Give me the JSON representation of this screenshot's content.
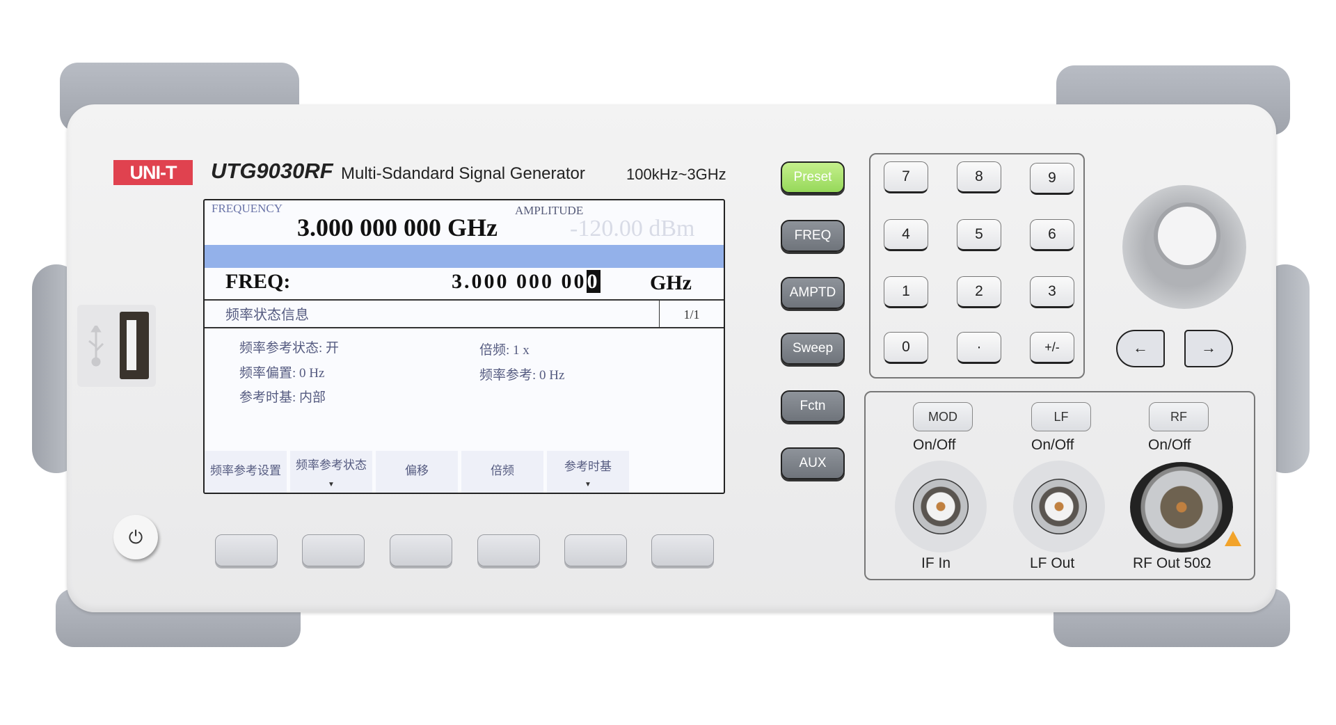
{
  "device": {
    "brand": "UNI-T",
    "model": "UTG9030RF",
    "description": "Multi-Sdandard Signal Generator",
    "range": "100kHz~3GHz"
  },
  "screen": {
    "frequency_label": "FREQUENCY",
    "frequency_value": "3.000 000 000 GHz",
    "amplitude_label": "AMPLITUDE",
    "amplitude_value": "-120.00 dBm",
    "edit_label": "FREQ:",
    "edit_value_prefix": "3.000 000 00",
    "edit_value_cursor": "0",
    "edit_unit": "GHz",
    "section_title": "频率状态信息",
    "page_indicator": "1/1",
    "info": [
      {
        "text": "频率参考状态: 开"
      },
      {
        "text": "倍频: 1 x"
      },
      {
        "text": "频率偏置: 0 Hz"
      },
      {
        "text": "频率参考: 0 Hz"
      },
      {
        "text": "参考时基: 内部"
      }
    ],
    "softkey_labels": [
      {
        "label": "频率参考设置",
        "has_dropdown": false
      },
      {
        "label": "频率参考状态",
        "has_dropdown": true
      },
      {
        "label": "偏移",
        "has_dropdown": false
      },
      {
        "label": "倍频",
        "has_dropdown": false
      },
      {
        "label": "参考时基",
        "has_dropdown": true
      }
    ],
    "dropdown_arrow": "▼"
  },
  "function_keys": {
    "preset": "Preset",
    "freq": "FREQ",
    "amptd": "AMPTD",
    "sweep": "Sweep",
    "fctn": "Fctn",
    "aux": "AUX"
  },
  "keypad": [
    "7",
    "8",
    "9",
    "4",
    "5",
    "6",
    "1",
    "2",
    "3",
    "0",
    "·",
    "+/-"
  ],
  "arrows": {
    "left": "←",
    "right": "→"
  },
  "output_keys": [
    {
      "label": "MOD",
      "state_label": "On/Off"
    },
    {
      "label": "LF",
      "state_label": "On/Off"
    },
    {
      "label": "RF",
      "state_label": "On/Off"
    }
  ],
  "connectors": [
    "IF In",
    "LF Out",
    "RF Out 50Ω"
  ],
  "icons": {
    "power": "⏻",
    "usb": "usb-icon",
    "warning": "warning-icon"
  },
  "colors": {
    "brand_red": "#e0424f",
    "preset_green": "#a6e06a",
    "screen_bar_blue": "#93b1ea",
    "warning_orange": "#f2a32a"
  }
}
